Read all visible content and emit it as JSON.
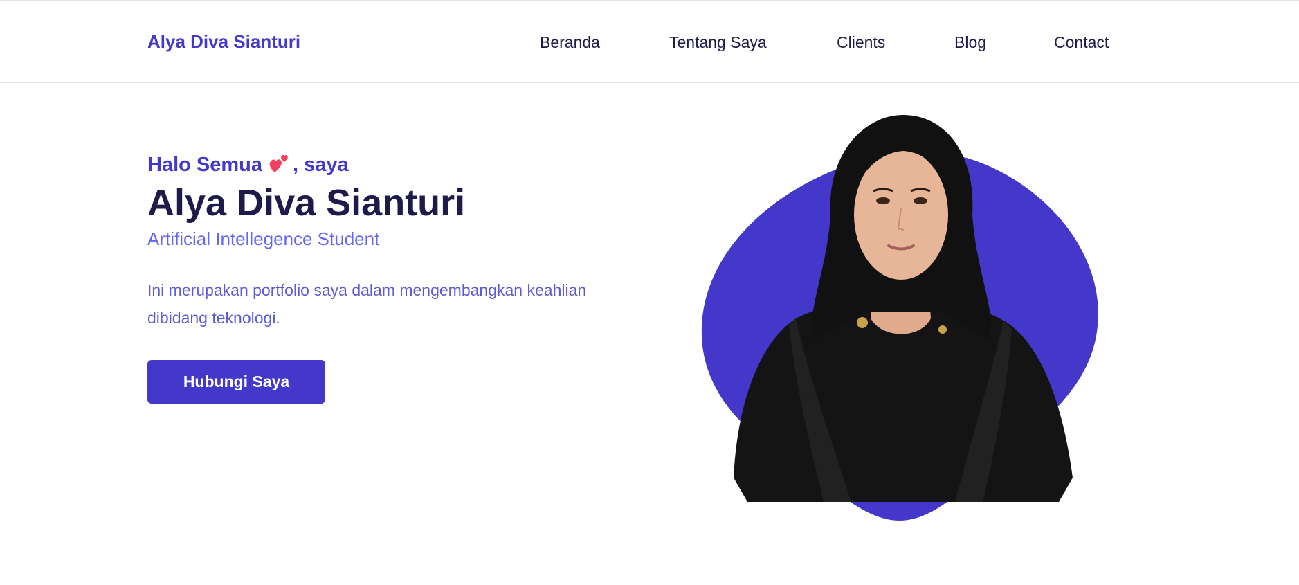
{
  "header": {
    "brand": "Alya Diva Sianturi",
    "nav": [
      "Beranda",
      "Tentang Saya",
      "Clients",
      "Blog",
      "Contact"
    ]
  },
  "hero": {
    "greeting_prefix": "Halo Semua",
    "greeting_icon": "two-hearts-icon",
    "greeting_suffix": ", saya",
    "name": "Alya Diva Sianturi",
    "role": "Artificial Intellegence Student",
    "description": "Ini merupakan portfolio saya dalam mengembangkan keahlian dibidang teknologi.",
    "cta_label": "Hubungi Saya"
  },
  "colors": {
    "accent": "#4338ca",
    "heading": "#1e1b4b",
    "subtle_accent": "#6366f1",
    "heart": "#f43f5e"
  }
}
